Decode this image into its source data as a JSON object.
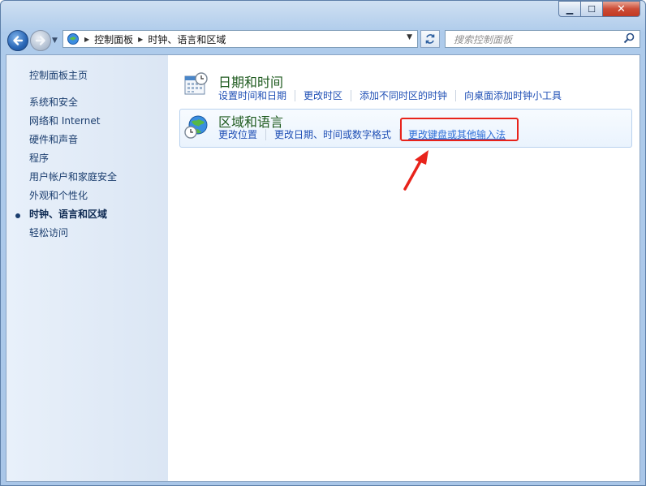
{
  "titlebar": {
    "min_label": "▁",
    "max_label": "☐",
    "close_label": "✕"
  },
  "nav": {
    "back_icon": "arrow-left-icon",
    "forward_icon": "arrow-right-icon",
    "breadcrumbs": [
      "控制面板",
      "时钟、语言和区域"
    ],
    "search_placeholder": "搜索控制面板"
  },
  "sidebar": {
    "items": [
      {
        "label": "控制面板主页"
      },
      {
        "label": "系统和安全"
      },
      {
        "label": "网络和 Internet"
      },
      {
        "label": "硬件和声音"
      },
      {
        "label": "程序"
      },
      {
        "label": "用户帐户和家庭安全"
      },
      {
        "label": "外观和个性化"
      },
      {
        "label": "时钟、语言和区域"
      },
      {
        "label": "轻松访问"
      }
    ],
    "active_index": 7
  },
  "categories": [
    {
      "title": "日期和时间",
      "icon": "calendar-clock-icon",
      "links": [
        "设置时间和日期",
        "更改时区",
        "添加不同时区的时钟",
        "向桌面添加时钟小工具"
      ]
    },
    {
      "title": "区域和语言",
      "icon": "globe-clock-icon",
      "links": [
        "更改位置",
        "更改日期、时间或数字格式",
        "更改键盘或其他输入法"
      ]
    }
  ],
  "annotation": {
    "highlight_color": "#e8231b"
  }
}
